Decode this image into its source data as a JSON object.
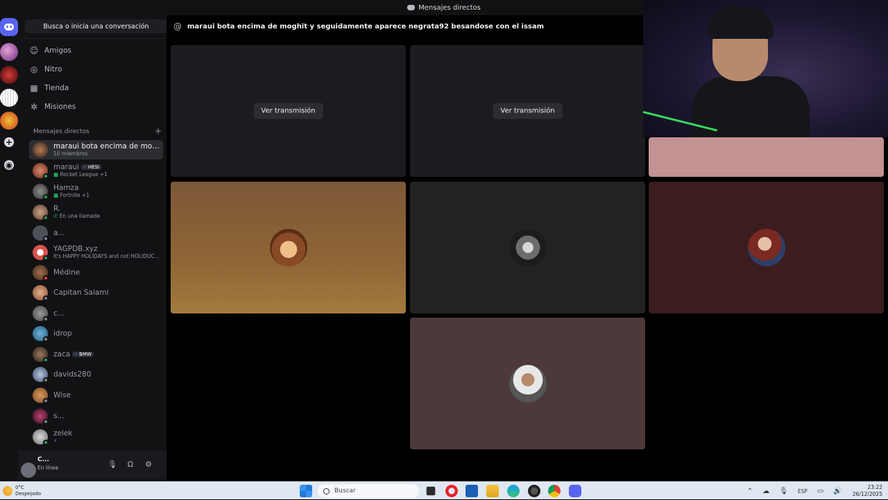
{
  "titlebar": {
    "title": "Mensajes directos"
  },
  "sidebar": {
    "search_label": "Busca o inicia una conversación",
    "nav": [
      {
        "label": "Amigos",
        "icon": "friends-icon"
      },
      {
        "label": "Nitro",
        "icon": "nitro-icon"
      },
      {
        "label": "Tienda",
        "icon": "store-icon"
      },
      {
        "label": "Misiones",
        "icon": "missions-icon"
      }
    ],
    "dm_header": "Mensajes directos",
    "dms": [
      {
        "name": "maraui bota encima de moghi...",
        "sub": "10 miembros",
        "status": "none"
      },
      {
        "name": "maraui",
        "badge": "HESI",
        "sub": "Rocket League +1",
        "status": "online"
      },
      {
        "name": "Hamza",
        "sub": "Fortnite +1",
        "status": "online"
      },
      {
        "name": "R.",
        "sub": "En una llamada",
        "status": "online"
      },
      {
        "name": "a...",
        "status": "offline"
      },
      {
        "name": "YAGPDB.xyz",
        "sub": "It's HAPPY HOLIDAYS and not HOLIDUC...",
        "status": "online"
      },
      {
        "name": "Médine",
        "status": "dnd"
      },
      {
        "name": "Capitan Salami",
        "status": "offline"
      },
      {
        "name": "c...",
        "status": "offline"
      },
      {
        "name": "idrop",
        "status": "offline"
      },
      {
        "name": "zaca",
        "badge": "BMW",
        "status": "online"
      },
      {
        "name": "davids280",
        "status": "offline"
      },
      {
        "name": "Wise",
        "status": "offline"
      },
      {
        "name": "s...",
        "status": "offline"
      },
      {
        "name": "zelek",
        "sub": "⚡",
        "status": "online"
      }
    ]
  },
  "user_panel": {
    "name": "C...",
    "status": "En línea"
  },
  "call": {
    "title": "maraui bota encima de moghit y seguidamente aparece negrata92 besandose con el issam",
    "watch_label": "Ver transmisión"
  },
  "taskbar": {
    "weather_temp": "0°C",
    "weather_desc": "Despejado",
    "search_placeholder": "Buscar",
    "lang": "ESP",
    "time": "23:22",
    "date": "26/12/2025"
  },
  "colors": {
    "accent": "#5865f2",
    "online": "#23a55a",
    "dnd": "#f23f43",
    "offline": "#80848e"
  }
}
